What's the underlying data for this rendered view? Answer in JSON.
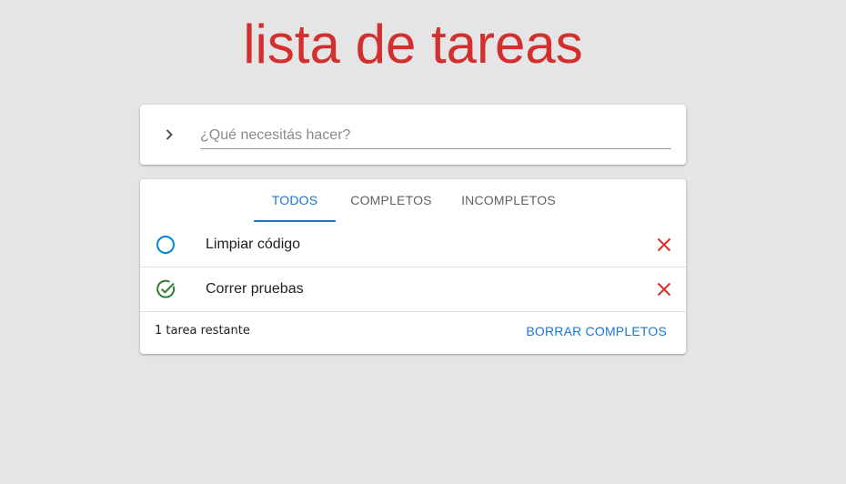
{
  "header": {
    "title": "lista de tareas",
    "title_color": "#d32f2f"
  },
  "input": {
    "toggle_icon": "chevron-right-icon",
    "placeholder": "¿Qué necesitás hacer?",
    "value": ""
  },
  "tabs": [
    {
      "label": "TODOS",
      "active": true
    },
    {
      "label": "COMPLETOS",
      "active": false
    },
    {
      "label": "INCOMPLETOS",
      "active": false
    }
  ],
  "todos": [
    {
      "text": "Limpiar código",
      "completed": false,
      "status_icon": "circle-outline-icon",
      "delete_icon": "close-icon"
    },
    {
      "text": "Correr pruebas",
      "completed": true,
      "status_icon": "check-circle-icon",
      "delete_icon": "close-icon"
    }
  ],
  "footer": {
    "remaining": "1 tarea restante",
    "clear_label": "BORRAR COMPLETOS"
  },
  "colors": {
    "accent": "#1976d2",
    "delete": "#d32f2f",
    "pending_circle": "#0288d1",
    "completed_check": "#2e7d32",
    "background": "#e5e5e5"
  }
}
